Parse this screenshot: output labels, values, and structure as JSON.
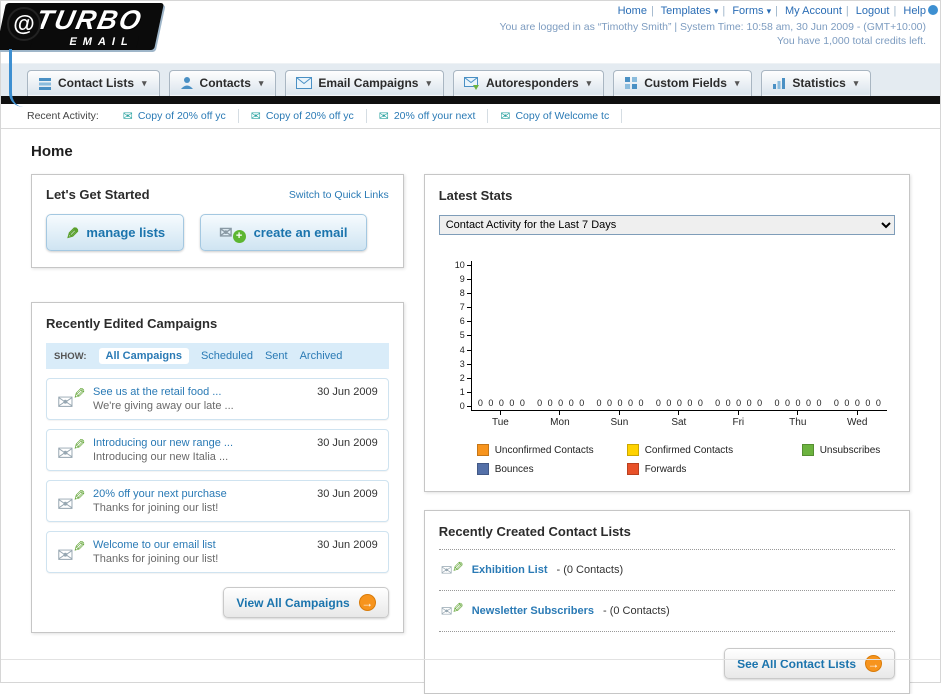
{
  "header": {
    "logo_line1": "TURBO",
    "logo_line2": "EMAIL",
    "links": [
      {
        "label": "Home",
        "has_menu": false
      },
      {
        "label": "Templates",
        "has_menu": true
      },
      {
        "label": "Forms",
        "has_menu": true
      },
      {
        "label": "My Account",
        "has_menu": false
      },
      {
        "label": "Logout",
        "has_menu": false
      },
      {
        "label": "Help",
        "has_menu": false
      }
    ],
    "login_info": "You are logged in as “Timothy Smith” | System Time: 10:58 am, 30 Jun 2009 - (GMT+10:00)",
    "credits": "You have 1,000 total credits left."
  },
  "icons": {
    "chevron_down": "▾",
    "envelope": "✉",
    "pencil": "✎",
    "plus": "+",
    "arrow_right": "→",
    "swirl": "@"
  },
  "nav": {
    "tabs": [
      {
        "label": "Contact Lists"
      },
      {
        "label": "Contacts"
      },
      {
        "label": "Email Campaigns"
      },
      {
        "label": "Autoresponders"
      },
      {
        "label": "Custom Fields"
      },
      {
        "label": "Statistics"
      }
    ]
  },
  "recent_activity": {
    "label": "Recent Activity:",
    "items": [
      {
        "text": "Copy of 20% off yc"
      },
      {
        "text": "Copy of 20% off yc"
      },
      {
        "text": "20% off your next"
      },
      {
        "text": "Copy of Welcome tc"
      }
    ]
  },
  "page_title": "Home",
  "get_started": {
    "title": "Let's Get Started",
    "switch_link": "Switch to Quick Links",
    "manage_lists_label": "manage lists",
    "create_email_label": "create an email"
  },
  "campaigns": {
    "title": "Recently Edited Campaigns",
    "show_label": "SHOW:",
    "tabs": [
      {
        "label": "All Campaigns",
        "active": true
      },
      {
        "label": "Scheduled",
        "active": false
      },
      {
        "label": "Sent",
        "active": false
      },
      {
        "label": "Archived",
        "active": false
      }
    ],
    "items": [
      {
        "title": "See us at the retail food ...",
        "subtitle": "We're giving away our late ...",
        "date": "30 Jun 2009"
      },
      {
        "title": "Introducing our new range ...",
        "subtitle": "Introducing our new Italia ...",
        "date": "30 Jun 2009"
      },
      {
        "title": "20% off your next purchase",
        "subtitle": "Thanks for joining our list!",
        "date": "30 Jun 2009"
      },
      {
        "title": "Welcome to our email list",
        "subtitle": "Thanks for joining our list!",
        "date": "30 Jun 2009"
      }
    ],
    "view_all_label": "View All Campaigns"
  },
  "stats": {
    "title": "Latest Stats",
    "dropdown_value": "Contact Activity for the Last 7 Days",
    "chart_data": {
      "type": "bar",
      "x": [
        "Tue",
        "Mon",
        "Sun",
        "Sat",
        "Fri",
        "Thu",
        "Wed"
      ],
      "series": [
        {
          "name": "Unconfirmed Contacts",
          "color": "#f7941d",
          "values": [
            0,
            0,
            0,
            0,
            0,
            0,
            0
          ]
        },
        {
          "name": "Confirmed Contacts",
          "color": "#ffd200",
          "values": [
            0,
            0,
            0,
            0,
            0,
            0,
            0
          ]
        },
        {
          "name": "Unsubscribes",
          "color": "#6cb33f",
          "values": [
            0,
            0,
            0,
            0,
            0,
            0,
            0
          ]
        },
        {
          "name": "Bounces",
          "color": "#5470a8",
          "values": [
            0,
            0,
            0,
            0,
            0,
            0,
            0
          ]
        },
        {
          "name": "Forwards",
          "color": "#e85129",
          "values": [
            0,
            0,
            0,
            0,
            0,
            0,
            0
          ]
        }
      ],
      "ylim": [
        0,
        10
      ],
      "ytick_step": 1,
      "grid": false,
      "legend_position": "bottom",
      "title": "",
      "xlabel": "",
      "ylabel": ""
    }
  },
  "contact_lists": {
    "title": "Recently Created Contact Lists",
    "items": [
      {
        "name": "Exhibition List",
        "count": "- (0 Contacts)"
      },
      {
        "name": "Newsletter Subscribers",
        "count": "- (0 Contacts)"
      }
    ],
    "see_all_label": "See All Contact Lists"
  }
}
